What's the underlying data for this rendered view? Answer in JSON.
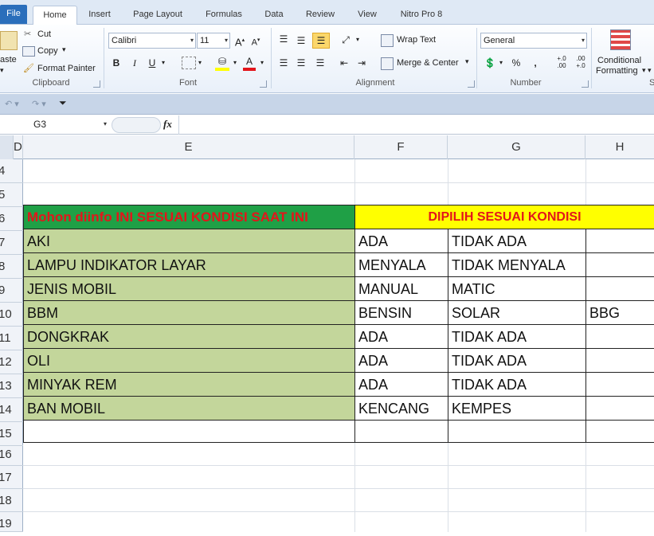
{
  "tabs": [
    "File",
    "Home",
    "Insert",
    "Page Layout",
    "Formulas",
    "Data",
    "Review",
    "View",
    "Nitro Pro 8"
  ],
  "clipboard": {
    "paste": "aste",
    "cut": "Cut",
    "copy": "Copy",
    "format_painter": "Format Painter",
    "group": "Clipboard"
  },
  "font": {
    "name": "Calibri",
    "size": "11",
    "bold": "B",
    "italic": "I",
    "underline": "U",
    "group": "Font"
  },
  "alignment": {
    "wrap": "Wrap Text",
    "merge": "Merge & Center",
    "group": "Alignment"
  },
  "number": {
    "format": "General",
    "percent": "%",
    "comma": ",",
    "inc": "+.0 .00",
    "dec": ".00 +.0",
    "group": "Number"
  },
  "styles": {
    "conditional": "Conditional",
    "formatting": "Formatting",
    "group": "S"
  },
  "formula_bar": {
    "name_box": "G3",
    "fx": "fx",
    "value": ""
  },
  "columns": [
    "D",
    "E",
    "F",
    "G",
    "H"
  ],
  "rows": [
    "4",
    "5",
    "6",
    "7",
    "8",
    "9",
    "10",
    "11",
    "12",
    "13",
    "14",
    "15",
    "16",
    "17",
    "18",
    "19"
  ],
  "header_row": {
    "left": "Mohon diinfo INI SESUAI KONDISI SAAT INI",
    "right": "DIPILIH SESUAI KONDISI"
  },
  "table": [
    {
      "item": "AKI",
      "f": "ADA",
      "g": "TIDAK ADA",
      "h": ""
    },
    {
      "item": "LAMPU INDIKATOR LAYAR",
      "f": "MENYALA",
      "g": "TIDAK MENYALA",
      "h": ""
    },
    {
      "item": "JENIS MOBIL",
      "f": "MANUAL",
      "g": "MATIC",
      "h": ""
    },
    {
      "item": "BBM",
      "f": "BENSIN",
      "g": "SOLAR",
      "h": "BBG"
    },
    {
      "item": "DONGKRAK",
      "f": "ADA",
      "g": "TIDAK ADA",
      "h": ""
    },
    {
      "item": "OLI",
      "f": "ADA",
      "g": "TIDAK ADA",
      "h": ""
    },
    {
      "item": "MINYAK REM",
      "f": "ADA",
      "g": "TIDAK ADA",
      "h": ""
    },
    {
      "item": "BAN MOBIL",
      "f": "KENCANG",
      "g": "KEMPES",
      "h": ""
    }
  ],
  "colors": {
    "green": "#c3d69b",
    "header_green": "#1fa046",
    "yellow": "#ffff00",
    "red": "#e3151b"
  }
}
